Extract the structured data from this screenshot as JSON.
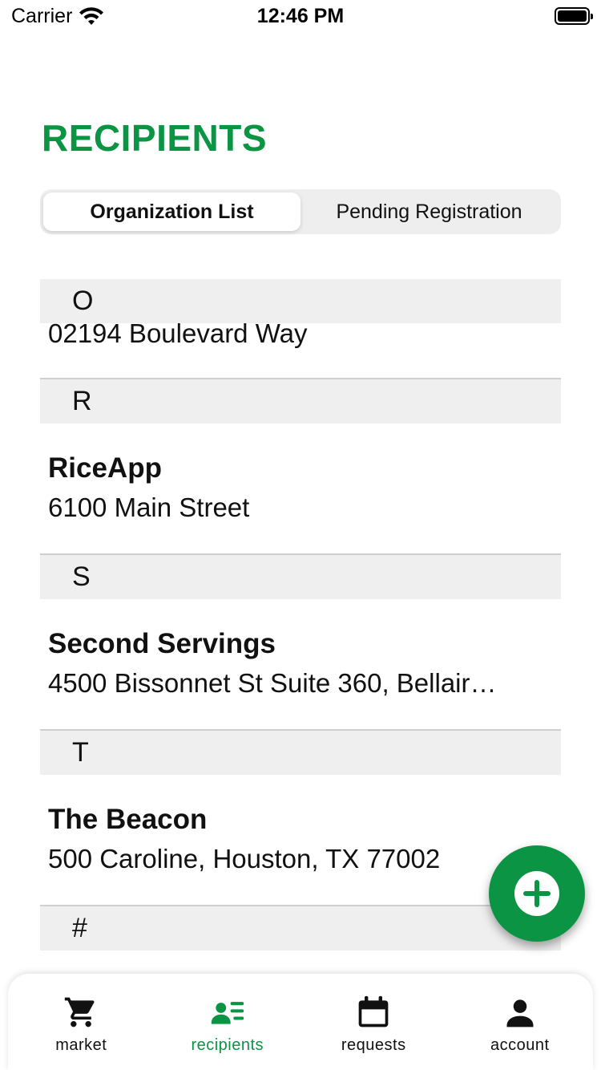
{
  "status_bar": {
    "carrier": "Carrier",
    "time": "12:46 PM"
  },
  "page": {
    "title": "RECIPIENTS",
    "accent_color": "#0b9444"
  },
  "segmented": {
    "tabs": [
      {
        "label": "Organization List",
        "selected": true
      },
      {
        "label": "Pending Registration",
        "selected": false
      }
    ]
  },
  "list": {
    "sections": [
      {
        "letter": "O",
        "rows": [
          {
            "name": "",
            "address": "02194 Boulevard Way"
          }
        ]
      },
      {
        "letter": "R",
        "rows": [
          {
            "name": "RiceApp",
            "address": "6100 Main Street"
          }
        ]
      },
      {
        "letter": "S",
        "rows": [
          {
            "name": "Second Servings",
            "address": "4500 Bissonnet St Suite 360, Bellair…"
          }
        ]
      },
      {
        "letter": "T",
        "rows": [
          {
            "name": "The Beacon",
            "address": "500 Caroline, Houston, TX 77002"
          }
        ]
      },
      {
        "letter": "#",
        "rows": []
      }
    ]
  },
  "fab": {
    "icon": "plus-icon"
  },
  "tabbar": {
    "items": [
      {
        "label": "market",
        "icon": "cart-icon",
        "active": false
      },
      {
        "label": "recipients",
        "icon": "contacts-icon",
        "active": true
      },
      {
        "label": "requests",
        "icon": "calendar-icon",
        "active": false
      },
      {
        "label": "account",
        "icon": "person-icon",
        "active": false
      }
    ]
  }
}
